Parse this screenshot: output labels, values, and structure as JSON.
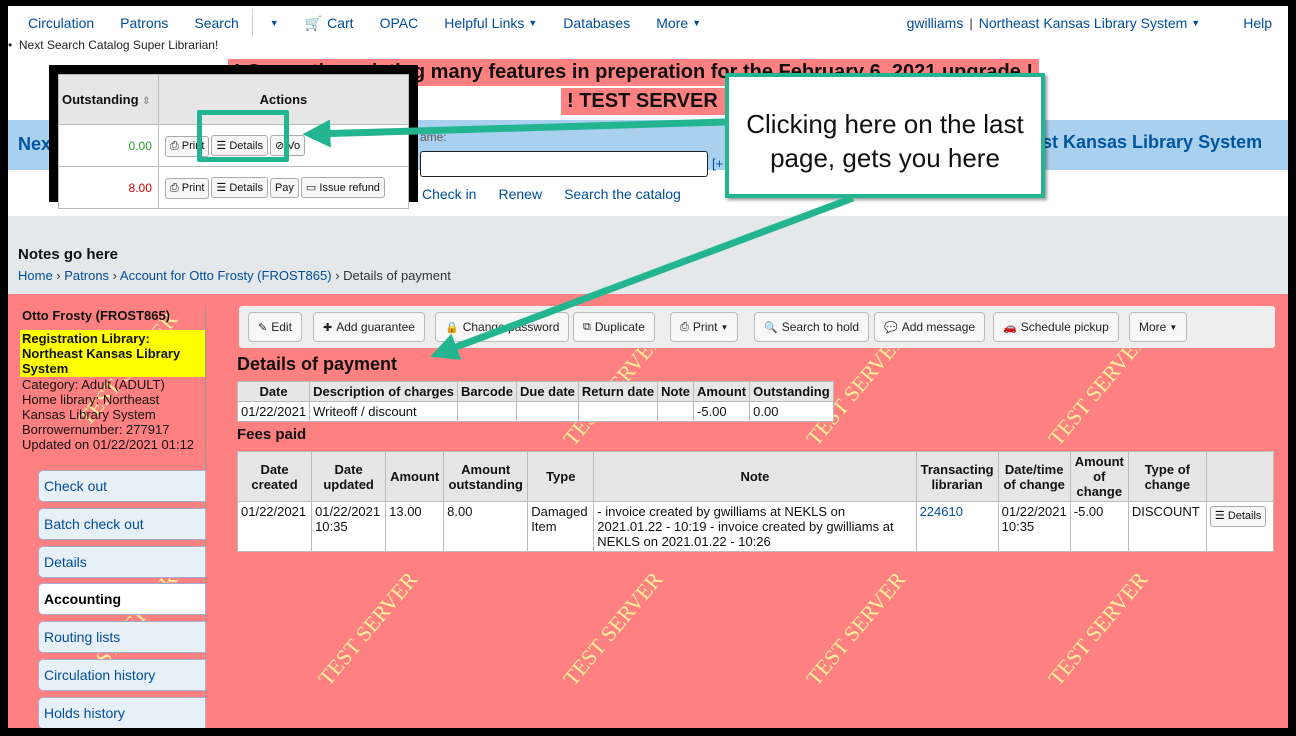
{
  "nav": {
    "items": [
      "Circulation",
      "Patrons",
      "Search",
      "Cart",
      "OPAC",
      "Helpful Links",
      "Databases",
      "More"
    ],
    "user": "gwilliams",
    "library": "Northeast Kansas Library System",
    "help": "Help",
    "next_search": "Next Search Catalog Super Librarian!"
  },
  "banner": {
    "upgrade": "! Currently updating many features in preperation for the February 6, 2021 upgrade !",
    "test": "! TEST SERVER !",
    "header_left": "Nex",
    "header_right": "st Kansas Library System",
    "name_hint": "ame:",
    "plus": "[+",
    "links": [
      "Check in",
      "Renew",
      "Search the catalog"
    ]
  },
  "notes": "Notes go here",
  "breadcrumb": {
    "home": "Home",
    "patrons": "Patrons",
    "account": "Account for Otto Frosty (FROST865)",
    "current": "Details of payment"
  },
  "patron": {
    "name": "Otto Frosty (FROST865)",
    "reg_library": "Registration Library: Northeast Kansas Library System",
    "category": "Category: Adult (ADULT)",
    "home_library": "Home library: Northeast Kansas Library System",
    "borrowernumber": "Borrowernumber: 277917",
    "updated": "Updated on 01/22/2021 01:12"
  },
  "sidebar": [
    "Check out",
    "Batch check out",
    "Details",
    "Accounting",
    "Routing lists",
    "Circulation history",
    "Holds history"
  ],
  "toolbar": [
    "Edit",
    "Add guarantee",
    "Change password",
    "Duplicate",
    "Print",
    "Search to hold",
    "Add message",
    "Schedule pickup",
    "More"
  ],
  "details_title": "Details of payment",
  "details_table": {
    "headers": [
      "Date",
      "Description of charges",
      "Barcode",
      "Due date",
      "Return date",
      "Note",
      "Amount",
      "Outstanding"
    ],
    "row": [
      "01/22/2021",
      "Writeoff / discount",
      "",
      "",
      "",
      "",
      "-5.00",
      "0.00"
    ]
  },
  "fees_title": "Fees paid",
  "fees_table": {
    "headers": [
      "Date created",
      "Date updated",
      "Amount",
      "Amount outstanding",
      "Type",
      "Note",
      "Transacting librarian",
      "Date/time of change",
      "Amount of change",
      "Type of change",
      ""
    ],
    "row": [
      "01/22/2021",
      "01/22/2021 10:35",
      "13.00",
      "8.00",
      "Damaged Item",
      "- invoice created by gwilliams at NEKLS on 2021.01.22 - 10:19 - invoice created by gwilliams at NEKLS on 2021.01.22 - 10:26",
      "224610",
      "01/22/2021 10:35",
      "-5.00",
      "DISCOUNT",
      "Details"
    ]
  },
  "inset": {
    "col_outstanding": "Outstanding",
    "col_actions": "Actions",
    "row1_amount": "0.00",
    "row2_amount": "8.00",
    "row1_buttons": [
      "Print",
      "Details",
      "Vo"
    ],
    "row2_buttons": [
      "Print",
      "Details",
      "Pay",
      "Issue refund"
    ]
  },
  "callout": "Clicking here on the last page, gets you here",
  "watermark": "TEST SERVER",
  "colors": {
    "accent": "#22b58f",
    "pink": "#ff8080",
    "link": "#004d99"
  }
}
